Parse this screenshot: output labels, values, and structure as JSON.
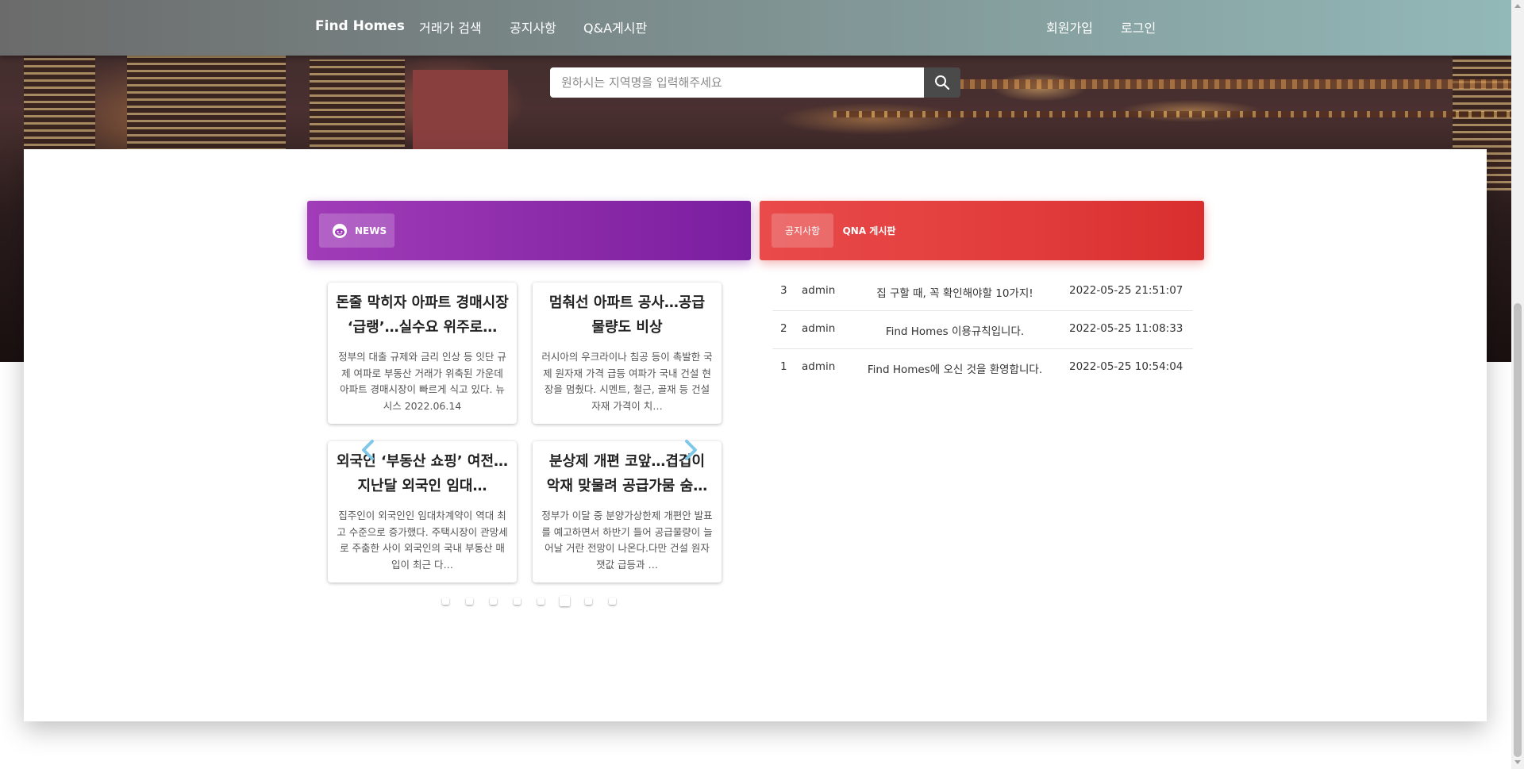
{
  "navbar": {
    "brand": "Find Homes",
    "links": [
      "거래가 검색",
      "공지사항",
      "Q&A게시판"
    ],
    "signup": "회원가입",
    "login": "로그인"
  },
  "search": {
    "placeholder": "원하시는 지역명을 입력해주세요",
    "icon": "search-icon"
  },
  "news_panel": {
    "tab_label": "NEWS",
    "tab_icon": "reddit-alien-icon",
    "cards": [
      {
        "title": "돈줄 막히자 아파트 경매시장 ‘급랭’…실수요 위주로…",
        "body": "정부의 대출 규제와 금리 인상 등 잇단 규제 여파로 부동산 거래가 위축된 가운데 아파트 경매시장이 빠르게 식고 있다. 뉴시스 2022.06.14"
      },
      {
        "title": "멈춰선 아파트 공사…공급 물량도 비상",
        "body": "러시아의 우크라이나 침공 등이 촉발한 국제 원자재 가격 급등 여파가 국내 건설 현장을 멈췄다. 시멘트, 철근, 골재 등 건설 자재 가격이 치…"
      },
      {
        "title": "외국인 ‘부동산 쇼핑’ 여전…지난달 외국인 임대…",
        "body": "집주인이 외국인인 임대차계약이 역대 최고 수준으로 증가했다. 주택시장이 관망세로 주춤한 사이 외국인의 국내 부동산 매입이 최근 다…"
      },
      {
        "title": "분상제 개편 코앞…겹겹이 악재 맞물려 공급가뭄 숨…",
        "body": "정부가 이달 중 분양가상한제 개편안 발표를 예고하면서 하반기 들어 공급물량이 늘어날 거란 전망이 나온다.다만 건설 원자잿값 급등과 …"
      }
    ],
    "prev_icon": "chevron-left-icon",
    "next_icon": "chevron-right-icon",
    "dots_count": 8,
    "active_dot": 6
  },
  "board_panel": {
    "tab_notice": "공지사항",
    "tab_qna": "QNA 게시판",
    "rows": [
      {
        "no": "3",
        "writer": "admin",
        "title": "집 구할 때, 꼭 확인해야할 10가지!",
        "date": "2022-05-25 21:51:07"
      },
      {
        "no": "2",
        "writer": "admin",
        "title": "Find Homes 이용규칙입니다.",
        "date": "2022-05-25 11:08:33"
      },
      {
        "no": "1",
        "writer": "admin",
        "title": "Find Homes에 오신 것을 환영합니다.",
        "date": "2022-05-25 10:54:04"
      }
    ]
  },
  "colors": {
    "news_gradient": [
      "#a13cb8",
      "#7a1ea0"
    ],
    "board_gradient": [
      "#e94a4a",
      "#d82e2e"
    ],
    "arrow": "#7fc8e8"
  }
}
